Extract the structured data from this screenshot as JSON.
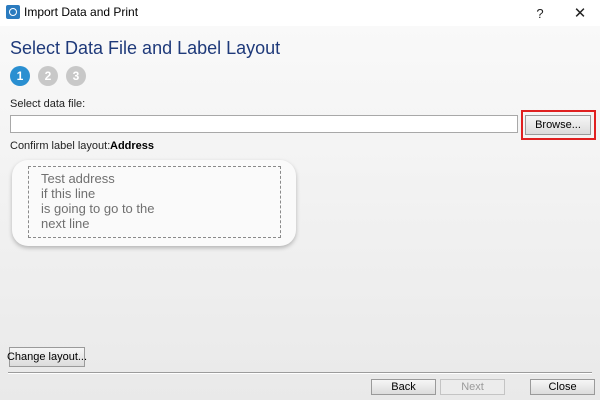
{
  "window": {
    "title": "Import Data and Print",
    "help_label": "?",
    "close_label": "✕"
  },
  "heading": "Select Data File and Label Layout",
  "steps": [
    "1",
    "2",
    "3"
  ],
  "active_step": 1,
  "data_file": {
    "label": "Select data file:",
    "value": "",
    "browse_label": "Browse..."
  },
  "confirm": {
    "label": "Confirm label layout:",
    "layout_name": "Address"
  },
  "preview": {
    "lines": [
      "Test address",
      "if this line",
      "is going to go to the",
      "next line"
    ]
  },
  "buttons": {
    "change_layout": "Change layout...",
    "back": "Back",
    "next": "Next",
    "close": "Close"
  },
  "colors": {
    "active_step": "#2a8fd1",
    "inactive_step": "#c8c8c8",
    "heading": "#1f3a7a",
    "highlight": "#e02020"
  }
}
